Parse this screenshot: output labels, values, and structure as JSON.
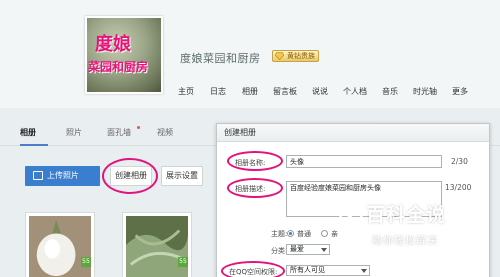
{
  "header": {
    "avatar_text_1": "度娘",
    "avatar_text_2": "菜园和厨房",
    "blog_title": "度娘菜园和厨房",
    "vip_badge": "黄钻贵族",
    "nav": [
      "主页",
      "日志",
      "相册",
      "留言板",
      "说说",
      "个人档",
      "音乐",
      "时光轴",
      "更多"
    ]
  },
  "tabs": [
    {
      "label": "相册",
      "active": true
    },
    {
      "label": "照片",
      "active": false
    },
    {
      "label": "面孔墙",
      "active": false,
      "dot": true
    },
    {
      "label": "视频",
      "active": false
    }
  ],
  "toolbar": {
    "upload": "上传照片",
    "create": "创建相册",
    "display": "展示设置"
  },
  "albums": [
    {
      "tag": "55"
    },
    {
      "tag": "55"
    }
  ],
  "dialog": {
    "title": "创建相册",
    "name_label": "相册名称:",
    "name_value": "头像",
    "name_counter": "2/30",
    "desc_label": "相册描述:",
    "desc_value": "百度经验度娘菜园和厨房头像",
    "desc_counter": "13/200",
    "theme_label": "主题:",
    "theme_opt1": "普通",
    "theme_opt2": "亲",
    "category_label": "分类:",
    "category_value": "最爱",
    "perm_label": "在QQ空间权限:",
    "perm_value": "所有人可见"
  },
  "watermark": {
    "big": "百科全说",
    "small": "助你轻松解决"
  },
  "colors": {
    "accent": "#3a7ed0",
    "highlight_circle": "#e0147a"
  }
}
